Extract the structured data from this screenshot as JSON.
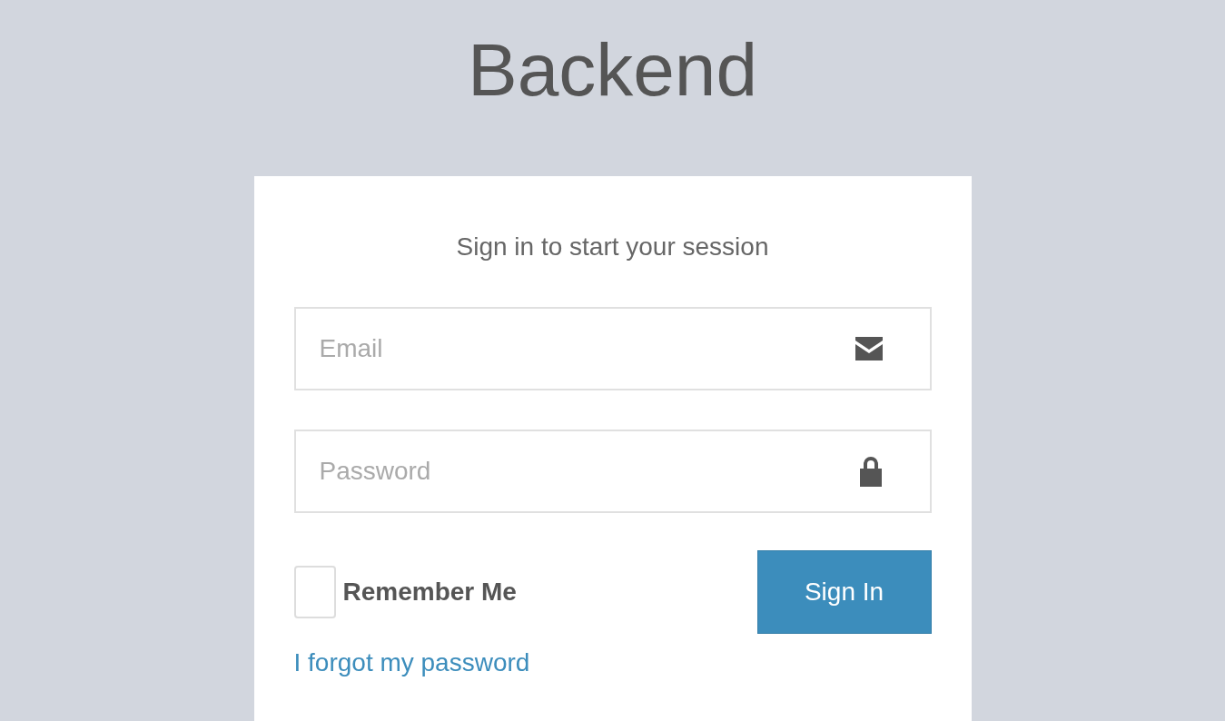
{
  "logo": "Backend",
  "login_box": {
    "message": "Sign in to start your session",
    "fields": [
      {
        "kind": "email",
        "placeholder": "Email"
      },
      {
        "kind": "password",
        "placeholder": "Password"
      }
    ],
    "remember": {
      "label": "Remember Me",
      "checked": false
    },
    "submit": "Sign In",
    "forgot_link": "I forgot my password"
  }
}
